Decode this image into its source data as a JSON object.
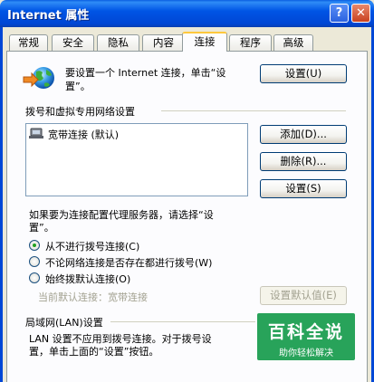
{
  "window": {
    "title": "Internet 属性",
    "help_glyph": "?",
    "close_glyph": "✕"
  },
  "tabs": [
    {
      "label": "常规"
    },
    {
      "label": "安全"
    },
    {
      "label": "隐私"
    },
    {
      "label": "内容"
    },
    {
      "label": "连接",
      "active": true
    },
    {
      "label": "程序"
    },
    {
      "label": "高级"
    }
  ],
  "setup": {
    "line1": "要设置一个 Internet 连接，单击“设",
    "line2": "置”。",
    "button": "设置(U)"
  },
  "dialup": {
    "group_title": "拨号和虚拟专用网络设置",
    "connections": [
      {
        "label": "宽带连接 (默认)"
      }
    ],
    "add_button": "添加(D)...",
    "remove_button": "删除(R)...",
    "settings_button": "设置(S)"
  },
  "proxy_note": {
    "line1": "如果要为连接配置代理服务器，请选择“设",
    "line2": "置”。"
  },
  "dial_options": [
    {
      "label": "从不进行拨号连接(C)",
      "selected": true
    },
    {
      "label": "不论网络连接是否存在都进行拨号(W)",
      "selected": false
    },
    {
      "label": "始终拨默认连接(O)",
      "selected": false
    }
  ],
  "current_default": {
    "label": "当前默认连接：宽带连接",
    "button": "设置默认值(E)"
  },
  "lan": {
    "group_title": "局域网(LAN)设置",
    "line1": "LAN 设置不应用到拨号连接。对于拨号设",
    "line2": "置，单击上面的“设置”按钮。"
  },
  "watermark": {
    "title": "百科全说",
    "subtitle": "助你轻松解决"
  },
  "colors": {
    "title_bar": "#0055E5",
    "dialog_bg": "#ECE9D8",
    "active_tab": "#FFC83C",
    "radio_dot": "#21A121",
    "watermark": "#28A35A"
  }
}
